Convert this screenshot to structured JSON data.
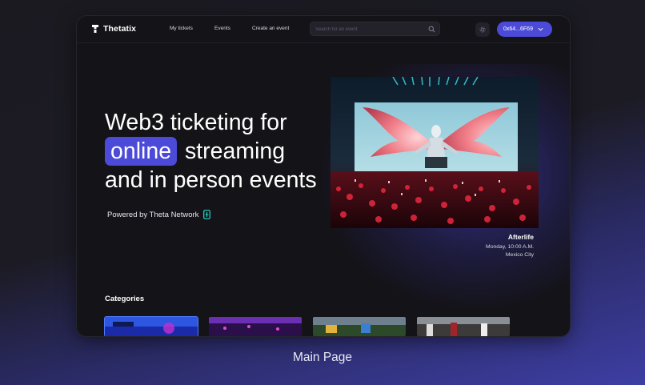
{
  "brand": {
    "name": "Thetatix"
  },
  "nav": {
    "items": [
      "My tickets",
      "Events",
      "Create an event"
    ]
  },
  "search": {
    "placeholder": "Search for an event"
  },
  "wallet": {
    "address": "0x64...6F69"
  },
  "hero": {
    "line1": "Web3 ticketing for",
    "highlight": "online",
    "line2_rest": "streaming",
    "line3": "and in person events",
    "powered_by": "Powered by Theta Network"
  },
  "featured_event": {
    "name": "Afterlife",
    "when": "Monday, 10:00 A.M.",
    "where": "Mexico City"
  },
  "categories": {
    "title": "Categories"
  },
  "caption": "Main Page",
  "colors": {
    "accent": "#4c4ad8",
    "background": "#141318",
    "theta": "#2ad8c4"
  },
  "icons": [
    "thetatix-logo-icon",
    "search-icon",
    "settings-icon",
    "chevron-down-icon",
    "theta-network-icon"
  ]
}
